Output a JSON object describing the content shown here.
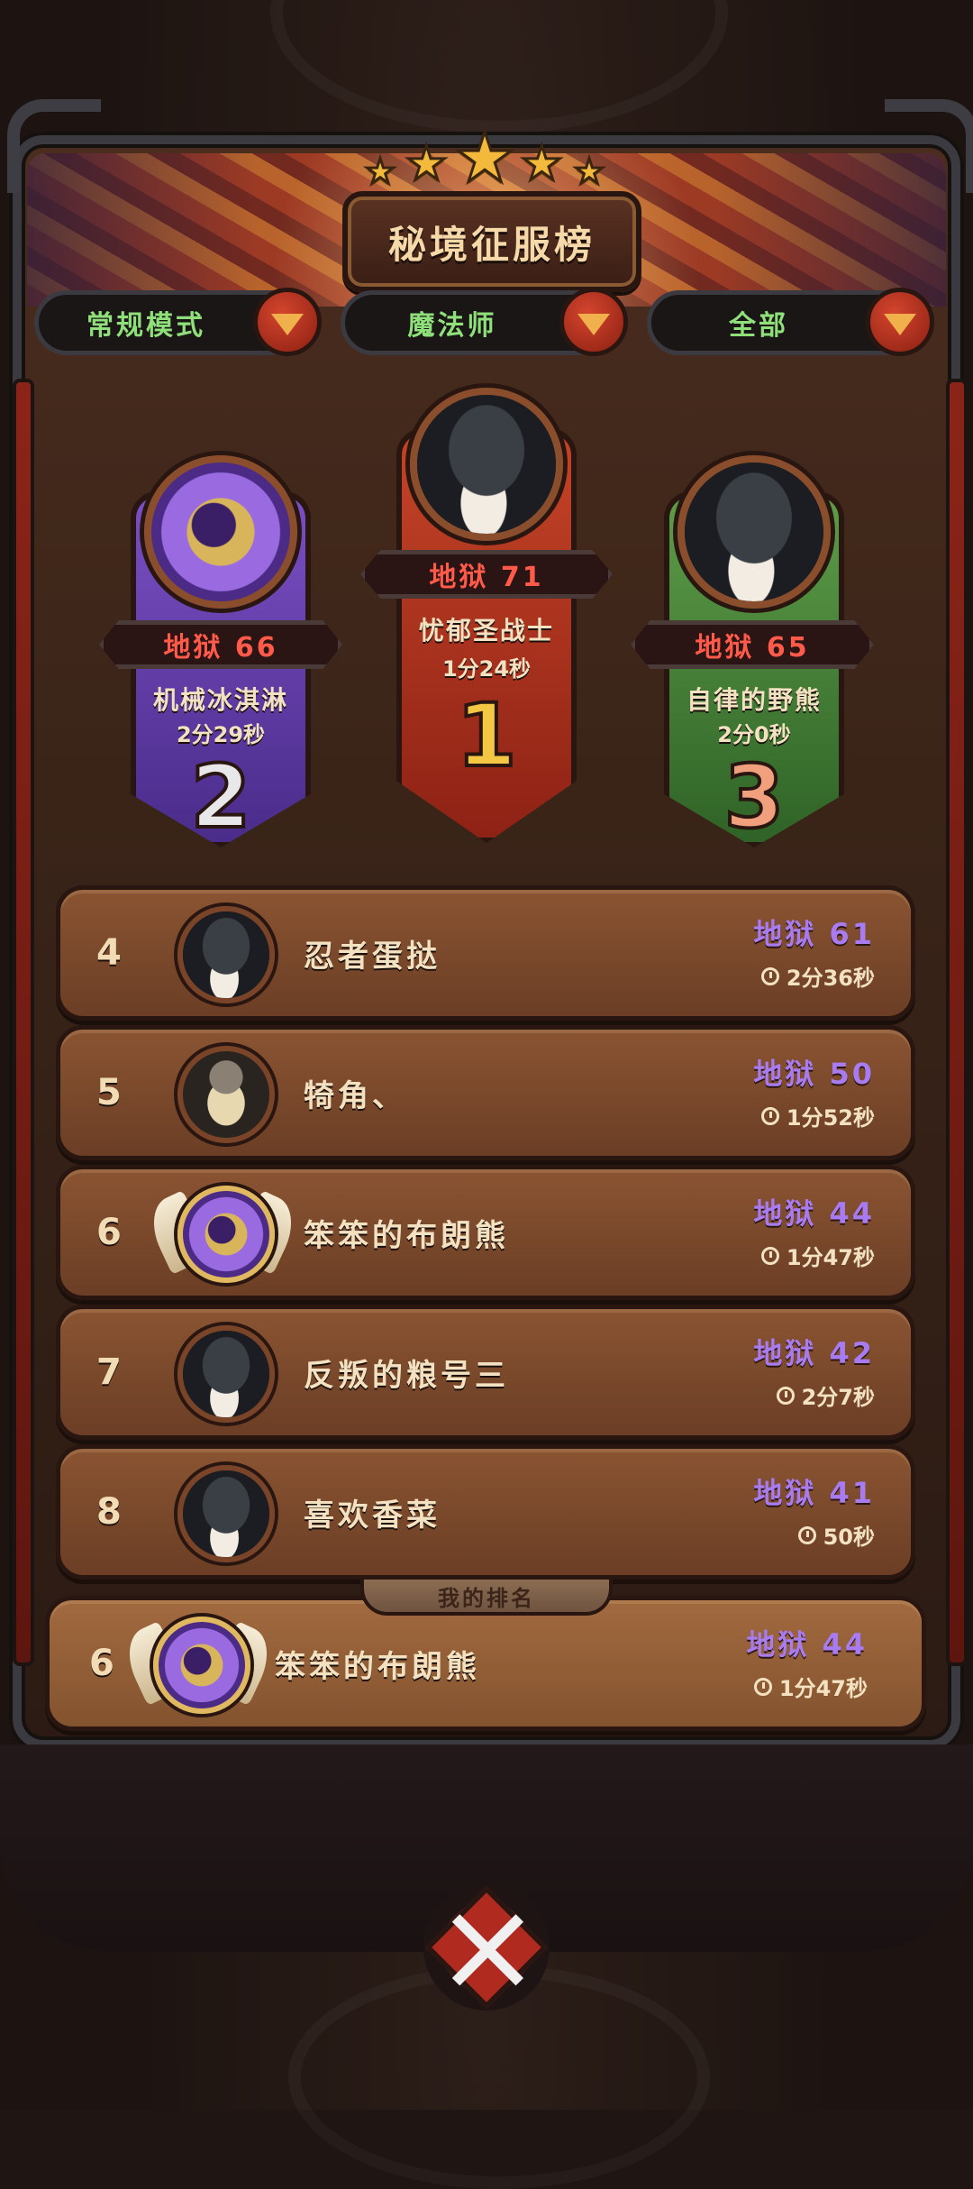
{
  "title": "秘境征服榜",
  "filters": [
    {
      "label": "常规模式"
    },
    {
      "label": "魔法师"
    },
    {
      "label": "全部"
    }
  ],
  "podium": {
    "first": {
      "rank": "1",
      "level": "地狱 71",
      "name": "忧郁圣战士",
      "time": "1分24秒"
    },
    "second": {
      "rank": "2",
      "level": "地狱 66",
      "name": "机械冰淇淋",
      "time": "2分29秒"
    },
    "third": {
      "rank": "3",
      "level": "地狱 65",
      "name": "自律的野熊",
      "time": "2分0秒"
    }
  },
  "rows": [
    {
      "rank": "4",
      "name": "忍者蛋挞",
      "level": "地狱 61",
      "time": "2分36秒"
    },
    {
      "rank": "5",
      "name": "犄角、",
      "level": "地狱 50",
      "time": "1分52秒"
    },
    {
      "rank": "6",
      "name": "笨笨的布朗熊",
      "level": "地狱 44",
      "time": "1分47秒"
    },
    {
      "rank": "7",
      "name": "反叛的粮号三",
      "level": "地狱 42",
      "time": "2分7秒"
    },
    {
      "rank": "8",
      "name": "喜欢香菜",
      "level": "地狱 41",
      "time": "50秒"
    }
  ],
  "my_rank": {
    "tab_label": "我的排名",
    "rank": "6",
    "name": "笨笨的布朗熊",
    "level": "地狱 44",
    "time": "1分47秒"
  },
  "colors": {
    "accent_purple": "#a87cf0",
    "level_red": "#ff5a4a",
    "filter_green": "#8fe07a"
  }
}
